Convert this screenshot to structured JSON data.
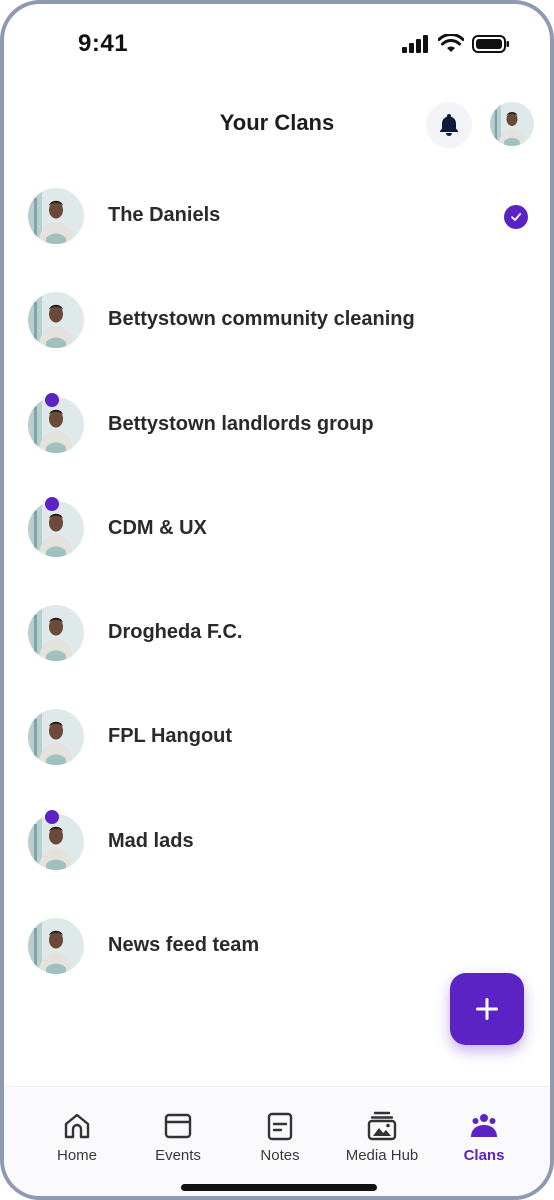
{
  "status_bar": {
    "time": "9:41"
  },
  "header": {
    "title": "Your Clans"
  },
  "clans": [
    {
      "name": "The Daniels",
      "selected": true,
      "unread": false
    },
    {
      "name": "Bettystown community cleaning",
      "selected": false,
      "unread": false
    },
    {
      "name": "Bettystown landlords group",
      "selected": false,
      "unread": true
    },
    {
      "name": "CDM & UX",
      "selected": false,
      "unread": true
    },
    {
      "name": "Drogheda F.C.",
      "selected": false,
      "unread": false
    },
    {
      "name": "FPL Hangout",
      "selected": false,
      "unread": false
    },
    {
      "name": "Mad lads",
      "selected": false,
      "unread": true
    },
    {
      "name": "News feed team",
      "selected": false,
      "unread": false
    }
  ],
  "bottom_nav": {
    "items": [
      {
        "label": "Home",
        "icon": "home-icon"
      },
      {
        "label": "Events",
        "icon": "events-icon"
      },
      {
        "label": "Notes",
        "icon": "notes-icon"
      },
      {
        "label": "Media Hub",
        "icon": "media-hub-icon"
      },
      {
        "label": "Clans",
        "icon": "clans-icon",
        "active": true
      }
    ]
  },
  "colors": {
    "accent": "#5b23c4",
    "bell": "#0f1b3d"
  }
}
